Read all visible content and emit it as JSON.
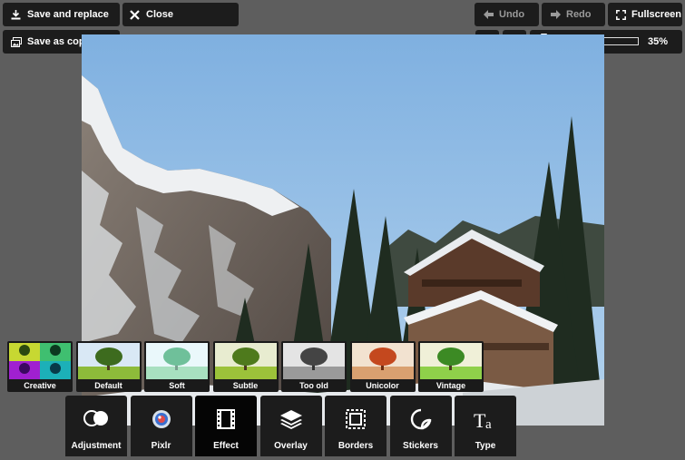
{
  "toolbar": {
    "save_replace": "Save and replace",
    "close": "Close",
    "save_copy": "Save as copy",
    "undo": "Undo",
    "redo": "Redo",
    "fullscreen": "Fullscreen"
  },
  "zoom": {
    "value_label": "35%",
    "level": 0.02
  },
  "effects": [
    {
      "label": "Creative"
    },
    {
      "label": "Default"
    },
    {
      "label": "Soft"
    },
    {
      "label": "Subtle"
    },
    {
      "label": "Too old"
    },
    {
      "label": "Unicolor"
    },
    {
      "label": "Vintage"
    }
  ],
  "tools": [
    {
      "label": "Adjustment",
      "icon": "circles-icon"
    },
    {
      "label": "Pixlr",
      "icon": "lens-icon"
    },
    {
      "label": "Effect",
      "icon": "film-icon",
      "active": true
    },
    {
      "label": "Overlay",
      "icon": "layers-icon"
    },
    {
      "label": "Borders",
      "icon": "frame-icon"
    },
    {
      "label": "Stickers",
      "icon": "sticker-icon"
    },
    {
      "label": "Type",
      "icon": "type-icon"
    }
  ],
  "colors": {
    "panel": "#1c1c1c",
    "background": "#5e5e5e",
    "active_tab": "#050505"
  }
}
